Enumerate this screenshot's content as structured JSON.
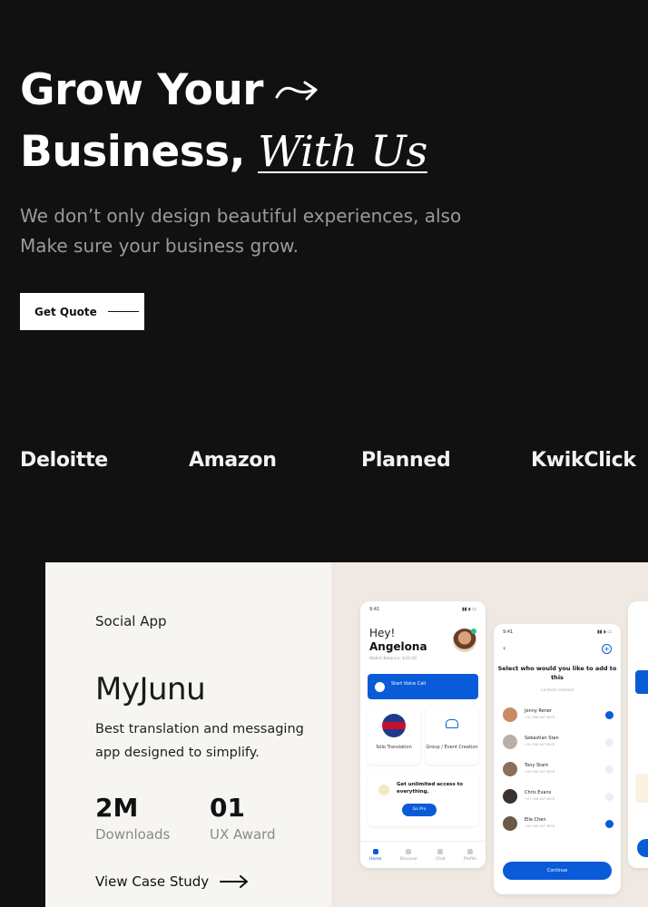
{
  "hero": {
    "title_line1": "Grow Your",
    "title_line2_plain": "Business,",
    "title_line2_accent": "With Us",
    "subtitle": "We don’t only design beautiful experiences, also Make sure your business grow.",
    "cta_label": "Get Quote"
  },
  "brands": [
    "Deloitte",
    "Amazon",
    "Planned",
    "KwikClick"
  ],
  "project": {
    "category": "Social App",
    "title": "MyJunu",
    "description": "Best translation and messaging app designed to simplify.",
    "stats": [
      {
        "value": "2M",
        "label": "Downloads"
      },
      {
        "value": "01",
        "label": "UX Award"
      }
    ],
    "link_label": "View Case Study"
  },
  "phone1": {
    "time": "9:41",
    "greeting": "Hey!",
    "user_name": "Angelona",
    "balance": "Wallet Balance: $33.40",
    "voice_call": "Start Voice Call",
    "tile1": "Solo Translation",
    "tile2": "Group / Event Creation",
    "promo_text": "Get unlimited access to everything.",
    "promo_button": "Go Pro",
    "nav": [
      "Home",
      "Discover",
      "Chat",
      "Profile"
    ]
  },
  "phone2": {
    "time": "9:41",
    "heading": "Select who would you like to add to this",
    "subtext": "Contacts selected",
    "contacts": [
      {
        "name": "Jenny Rener",
        "phone": "+91 996 487 9878"
      },
      {
        "name": "Sebastian Stan",
        "phone": "+91 996 487 9878"
      },
      {
        "name": "Tony Stark",
        "phone": "+91 996 487 9878"
      },
      {
        "name": "Chris Evans",
        "phone": "+91 996 487 9878"
      },
      {
        "name": "Elle Chen",
        "phone": "+91 996 487 9878"
      }
    ],
    "continue_label": "Continue"
  },
  "colors": {
    "background": "#111111",
    "accent_blue": "#0a5bd8",
    "card_bg": "#f7f5f2",
    "mock_bg": "#f0e9e3"
  }
}
